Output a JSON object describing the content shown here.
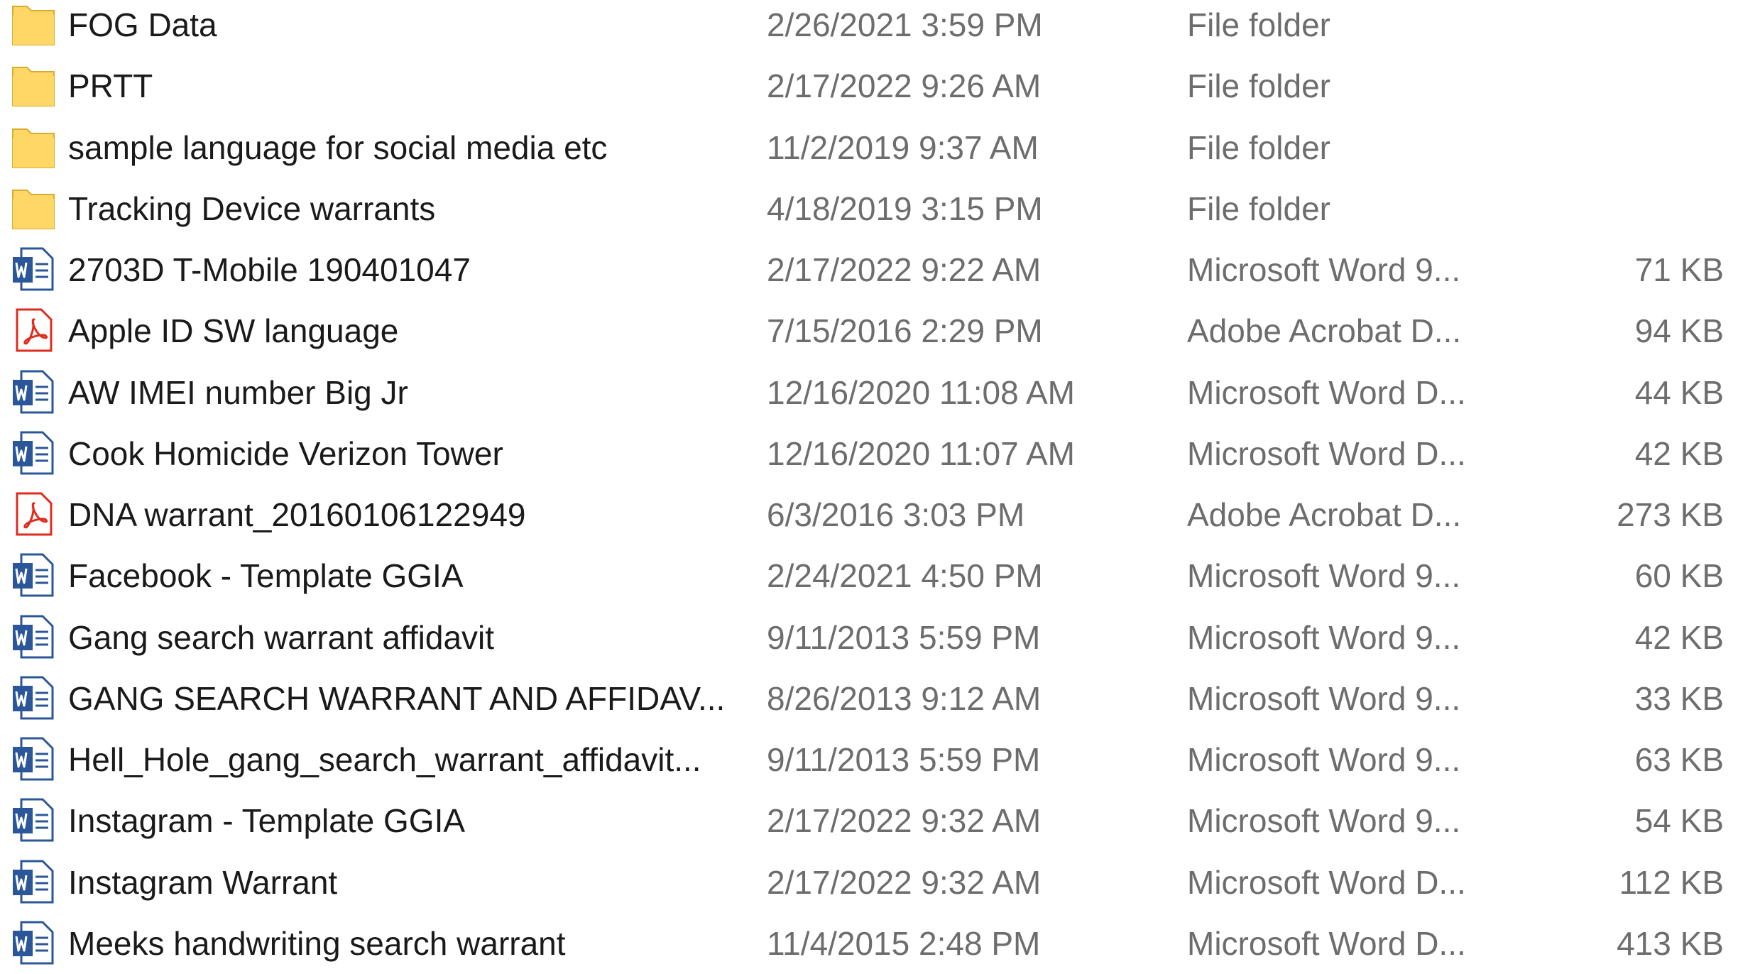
{
  "colors": {
    "folder": "#ffd767",
    "word_blue": "#2b579a",
    "pdf_red": "#e02b1c",
    "name_text": "#1a1a1a",
    "detail_text": "#6d6d6d"
  },
  "files": [
    {
      "icon": "folder-icon",
      "name": "FOG Data",
      "date": "2/26/2021 3:59 PM",
      "type": "File folder",
      "size": ""
    },
    {
      "icon": "folder-icon",
      "name": "PRTT",
      "date": "2/17/2022 9:26 AM",
      "type": "File folder",
      "size": ""
    },
    {
      "icon": "folder-icon",
      "name": "sample language for social media etc",
      "date": "11/2/2019 9:37 AM",
      "type": "File folder",
      "size": ""
    },
    {
      "icon": "folder-icon",
      "name": "Tracking Device warrants",
      "date": "4/18/2019 3:15 PM",
      "type": "File folder",
      "size": ""
    },
    {
      "icon": "word-document-icon",
      "name": "2703D T-Mobile 190401047",
      "date": "2/17/2022 9:22 AM",
      "type": "Microsoft Word 9...",
      "size": "71 KB"
    },
    {
      "icon": "pdf-document-icon",
      "name": "Apple ID SW language",
      "date": "7/15/2016 2:29 PM",
      "type": "Adobe Acrobat D...",
      "size": "94 KB"
    },
    {
      "icon": "word-document-icon",
      "name": "AW  IMEI number Big Jr",
      "date": "12/16/2020 11:08 AM",
      "type": "Microsoft Word D...",
      "size": "44 KB"
    },
    {
      "icon": "word-document-icon",
      "name": "Cook Homicide Verizon Tower",
      "date": "12/16/2020 11:07 AM",
      "type": "Microsoft Word D...",
      "size": "42 KB"
    },
    {
      "icon": "pdf-document-icon",
      "name": "DNA warrant_20160106122949",
      "date": "6/3/2016 3:03 PM",
      "type": "Adobe Acrobat D...",
      "size": "273 KB"
    },
    {
      "icon": "word-document-icon",
      "name": "Facebook - Template GGIA",
      "date": "2/24/2021 4:50 PM",
      "type": "Microsoft Word 9...",
      "size": "60 KB"
    },
    {
      "icon": "word-document-icon",
      "name": "Gang search warrant affidavit",
      "date": "9/11/2013 5:59 PM",
      "type": "Microsoft Word 9...",
      "size": "42 KB"
    },
    {
      "icon": "word-document-icon",
      "name": "GANG SEARCH WARRANT AND AFFIDAV...",
      "date": "8/26/2013 9:12 AM",
      "type": "Microsoft Word 9...",
      "size": "33 KB"
    },
    {
      "icon": "word-document-icon",
      "name": "Hell_Hole_gang_search_warrant_affidavit...",
      "date": "9/11/2013 5:59 PM",
      "type": "Microsoft Word 9...",
      "size": "63 KB"
    },
    {
      "icon": "word-document-icon",
      "name": "Instagram - Template GGIA",
      "date": "2/17/2022 9:32 AM",
      "type": "Microsoft Word 9...",
      "size": "54 KB"
    },
    {
      "icon": "word-document-icon",
      "name": "Instagram Warrant",
      "date": "2/17/2022 9:32 AM",
      "type": "Microsoft Word D...",
      "size": "112 KB"
    },
    {
      "icon": "word-document-icon",
      "name": "Meeks handwriting search warrant",
      "date": "11/4/2015 2:48 PM",
      "type": "Microsoft Word D...",
      "size": "413 KB"
    }
  ]
}
